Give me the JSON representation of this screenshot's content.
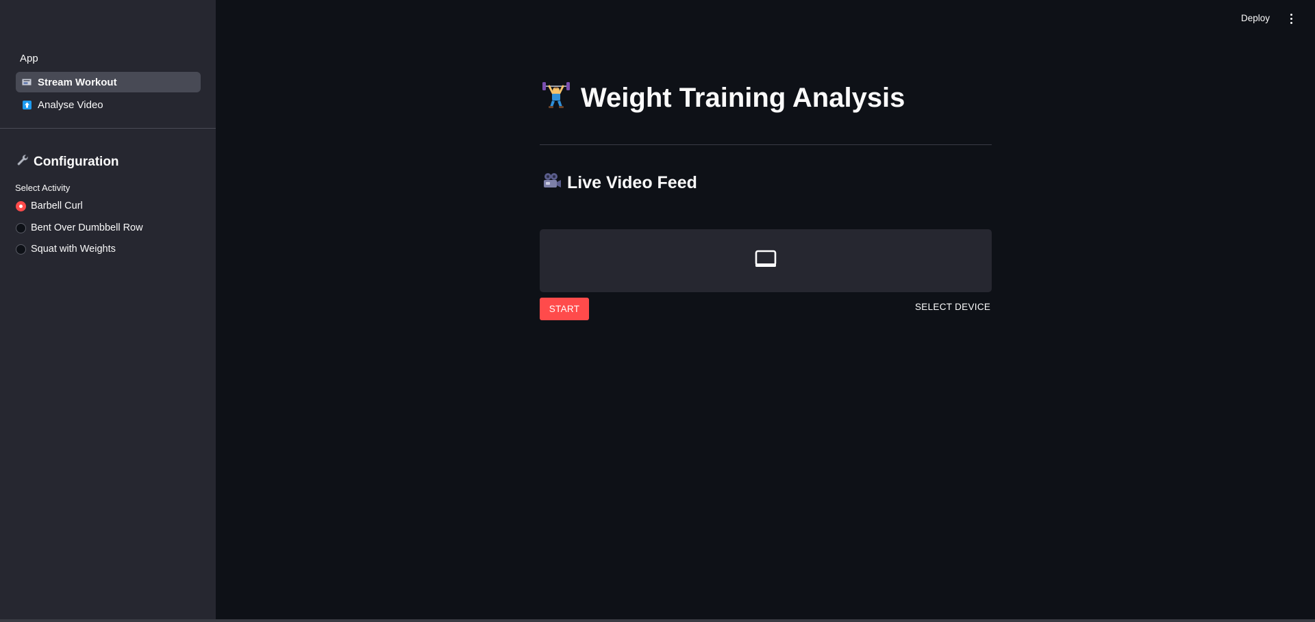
{
  "sidebar": {
    "nav_header": "App",
    "nav_items": [
      {
        "label": "Stream Workout",
        "icon": "video-camera-icon",
        "active": true
      },
      {
        "label": "Analyse Video",
        "icon": "upload-arrow-icon",
        "active": false
      }
    ],
    "config_title": "Configuration",
    "config_icon": "wrench-icon",
    "select_label": "Select Activity",
    "options": [
      {
        "label": "Barbell Curl",
        "selected": true
      },
      {
        "label": "Bent Over Dumbbell Row",
        "selected": false
      },
      {
        "label": "Squat with Weights",
        "selected": false
      }
    ]
  },
  "header": {
    "deploy_label": "Deploy",
    "menu_icon": "kebab-menu-icon"
  },
  "main": {
    "title": "Weight Training Analysis",
    "title_icon": "weightlifter-icon",
    "subtitle": "Live Video Feed",
    "subtitle_icon": "movie-camera-icon",
    "video_placeholder_icon": "monitor-icon",
    "start_label": "START",
    "select_device_label": "SELECT DEVICE"
  },
  "colors": {
    "background": "#0e1117",
    "sidebar": "#262730",
    "accent": "#ff4b4b",
    "active_nav": "#484a55",
    "text": "#fafafa"
  }
}
